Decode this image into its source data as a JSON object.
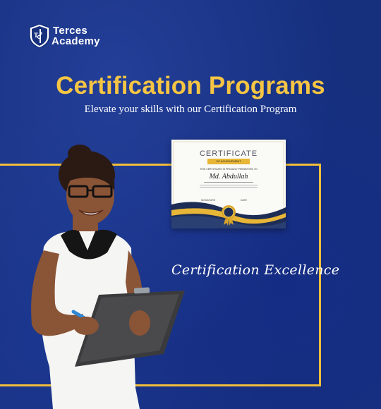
{
  "brand": {
    "line1": "Terces",
    "line2": "Academy",
    "logo_icon": "shield-logo-icon"
  },
  "headline": {
    "title": "Certification Programs",
    "subtitle": "Elevate your skills with our Certification Program"
  },
  "certificate": {
    "title": "CERTIFICATE",
    "ribbon": "OF ACHIEVEMENT",
    "presented_to": "THIS CERTIFICATE IS PROUDLY PRESENTED TO",
    "name": "Md. Abdullah",
    "signature_label": "SIGNATURE",
    "date_label": "DATE",
    "seal_icon": "gold-seal-icon"
  },
  "tagline": "Certification Excellence",
  "colors": {
    "background": "#16307e",
    "accent": "#f6c543",
    "frame": "#f0be3a"
  }
}
